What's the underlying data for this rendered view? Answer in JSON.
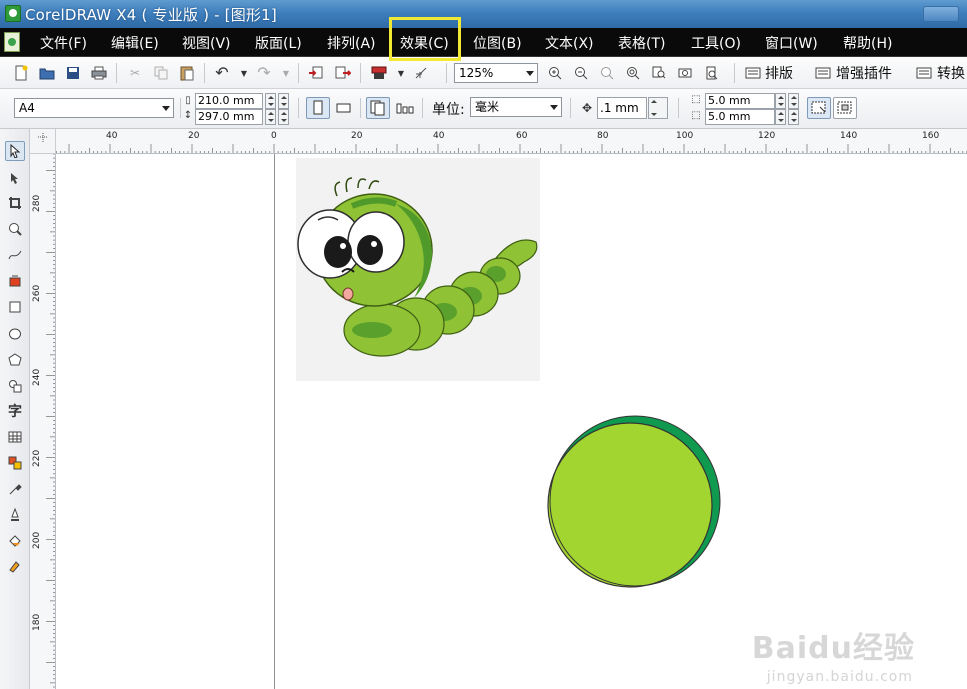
{
  "titlebar": {
    "title": "CorelDRAW X4 ( 专业版 ) - [图形1]"
  },
  "menubar": {
    "items": [
      {
        "label": "文件(F)"
      },
      {
        "label": "编辑(E)"
      },
      {
        "label": "视图(V)"
      },
      {
        "label": "版面(L)"
      },
      {
        "label": "排列(A)"
      },
      {
        "label": "效果(C)",
        "highlighted": true
      },
      {
        "label": "位图(B)"
      },
      {
        "label": "文本(X)"
      },
      {
        "label": "表格(T)"
      },
      {
        "label": "工具(O)"
      },
      {
        "label": "窗口(W)"
      },
      {
        "label": "帮助(H)"
      }
    ]
  },
  "standard_toolbar": {
    "zoom_value": "125%",
    "buttons": [
      "new-icon",
      "open-icon",
      "save-icon",
      "print-icon",
      "cut-icon",
      "copy-icon",
      "paste-icon",
      "undo-icon",
      "redo-icon",
      "import-icon",
      "export-icon",
      "launcher-icon",
      "snap-icon",
      "zoom-in-icon",
      "zoom-out-icon",
      "zoom-selected-icon",
      "zoom-all-icon",
      "zoom-page-icon",
      "zoom-width-icon",
      "zoom-height-icon"
    ],
    "plugins": [
      {
        "label": "排版"
      },
      {
        "label": "增强插件"
      },
      {
        "label": "转换"
      }
    ]
  },
  "property_bar": {
    "paper_size": "A4",
    "width": "210.0 mm",
    "height": "297.0 mm",
    "units_label": "单位:",
    "units_value": "毫米",
    "nudge": ".1 mm",
    "dup_x": "5.0 mm",
    "dup_y": "5.0 mm"
  },
  "rulers": {
    "horizontal_labels": [
      "40",
      "20",
      "0",
      "20",
      "40",
      "60",
      "80",
      "100",
      "120",
      "140",
      "160"
    ],
    "vertical_labels": [
      "280",
      "260",
      "240",
      "220",
      "200",
      "180"
    ]
  },
  "toolbox": {
    "tools": [
      "pick-tool-icon",
      "shape-tool-icon",
      "crop-tool-icon",
      "zoom-tool-icon",
      "freehand-tool-icon",
      "smart-fill-icon",
      "rectangle-tool-icon",
      "ellipse-tool-icon",
      "polygon-tool-icon",
      "basic-shapes-icon",
      "text-tool-icon",
      "table-tool-icon",
      "interactive-blend-icon",
      "eyedropper-tool-icon",
      "outline-tool-icon",
      "fill-tool-icon",
      "interactive-fill-icon"
    ],
    "text_tool_glyph": "字"
  },
  "canvas": {
    "watermark": "Baidu经验",
    "watermark_url": "jingyan.baidu.com",
    "circle_light_color": "#a3d531",
    "circle_dark_color": "#0f9a4f",
    "caterpillar_color": "#8fc234"
  },
  "colors": {
    "title_bar": "#3f7fbd",
    "menu_bar": "#0a0a0a",
    "highlight_box": "#f2ea32"
  }
}
